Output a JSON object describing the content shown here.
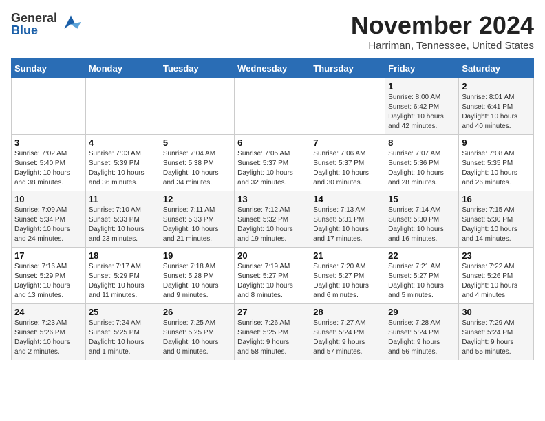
{
  "header": {
    "logo_general": "General",
    "logo_blue": "Blue",
    "month_year": "November 2024",
    "location": "Harriman, Tennessee, United States"
  },
  "days_of_week": [
    "Sunday",
    "Monday",
    "Tuesday",
    "Wednesday",
    "Thursday",
    "Friday",
    "Saturday"
  ],
  "weeks": [
    [
      {
        "day": "",
        "info": ""
      },
      {
        "day": "",
        "info": ""
      },
      {
        "day": "",
        "info": ""
      },
      {
        "day": "",
        "info": ""
      },
      {
        "day": "",
        "info": ""
      },
      {
        "day": "1",
        "info": "Sunrise: 8:00 AM\nSunset: 6:42 PM\nDaylight: 10 hours\nand 42 minutes."
      },
      {
        "day": "2",
        "info": "Sunrise: 8:01 AM\nSunset: 6:41 PM\nDaylight: 10 hours\nand 40 minutes."
      }
    ],
    [
      {
        "day": "3",
        "info": "Sunrise: 7:02 AM\nSunset: 5:40 PM\nDaylight: 10 hours\nand 38 minutes."
      },
      {
        "day": "4",
        "info": "Sunrise: 7:03 AM\nSunset: 5:39 PM\nDaylight: 10 hours\nand 36 minutes."
      },
      {
        "day": "5",
        "info": "Sunrise: 7:04 AM\nSunset: 5:38 PM\nDaylight: 10 hours\nand 34 minutes."
      },
      {
        "day": "6",
        "info": "Sunrise: 7:05 AM\nSunset: 5:37 PM\nDaylight: 10 hours\nand 32 minutes."
      },
      {
        "day": "7",
        "info": "Sunrise: 7:06 AM\nSunset: 5:37 PM\nDaylight: 10 hours\nand 30 minutes."
      },
      {
        "day": "8",
        "info": "Sunrise: 7:07 AM\nSunset: 5:36 PM\nDaylight: 10 hours\nand 28 minutes."
      },
      {
        "day": "9",
        "info": "Sunrise: 7:08 AM\nSunset: 5:35 PM\nDaylight: 10 hours\nand 26 minutes."
      }
    ],
    [
      {
        "day": "10",
        "info": "Sunrise: 7:09 AM\nSunset: 5:34 PM\nDaylight: 10 hours\nand 24 minutes."
      },
      {
        "day": "11",
        "info": "Sunrise: 7:10 AM\nSunset: 5:33 PM\nDaylight: 10 hours\nand 23 minutes."
      },
      {
        "day": "12",
        "info": "Sunrise: 7:11 AM\nSunset: 5:33 PM\nDaylight: 10 hours\nand 21 minutes."
      },
      {
        "day": "13",
        "info": "Sunrise: 7:12 AM\nSunset: 5:32 PM\nDaylight: 10 hours\nand 19 minutes."
      },
      {
        "day": "14",
        "info": "Sunrise: 7:13 AM\nSunset: 5:31 PM\nDaylight: 10 hours\nand 17 minutes."
      },
      {
        "day": "15",
        "info": "Sunrise: 7:14 AM\nSunset: 5:30 PM\nDaylight: 10 hours\nand 16 minutes."
      },
      {
        "day": "16",
        "info": "Sunrise: 7:15 AM\nSunset: 5:30 PM\nDaylight: 10 hours\nand 14 minutes."
      }
    ],
    [
      {
        "day": "17",
        "info": "Sunrise: 7:16 AM\nSunset: 5:29 PM\nDaylight: 10 hours\nand 13 minutes."
      },
      {
        "day": "18",
        "info": "Sunrise: 7:17 AM\nSunset: 5:29 PM\nDaylight: 10 hours\nand 11 minutes."
      },
      {
        "day": "19",
        "info": "Sunrise: 7:18 AM\nSunset: 5:28 PM\nDaylight: 10 hours\nand 9 minutes."
      },
      {
        "day": "20",
        "info": "Sunrise: 7:19 AM\nSunset: 5:27 PM\nDaylight: 10 hours\nand 8 minutes."
      },
      {
        "day": "21",
        "info": "Sunrise: 7:20 AM\nSunset: 5:27 PM\nDaylight: 10 hours\nand 6 minutes."
      },
      {
        "day": "22",
        "info": "Sunrise: 7:21 AM\nSunset: 5:27 PM\nDaylight: 10 hours\nand 5 minutes."
      },
      {
        "day": "23",
        "info": "Sunrise: 7:22 AM\nSunset: 5:26 PM\nDaylight: 10 hours\nand 4 minutes."
      }
    ],
    [
      {
        "day": "24",
        "info": "Sunrise: 7:23 AM\nSunset: 5:26 PM\nDaylight: 10 hours\nand 2 minutes."
      },
      {
        "day": "25",
        "info": "Sunrise: 7:24 AM\nSunset: 5:25 PM\nDaylight: 10 hours\nand 1 minute."
      },
      {
        "day": "26",
        "info": "Sunrise: 7:25 AM\nSunset: 5:25 PM\nDaylight: 10 hours\nand 0 minutes."
      },
      {
        "day": "27",
        "info": "Sunrise: 7:26 AM\nSunset: 5:25 PM\nDaylight: 9 hours\nand 58 minutes."
      },
      {
        "day": "28",
        "info": "Sunrise: 7:27 AM\nSunset: 5:24 PM\nDaylight: 9 hours\nand 57 minutes."
      },
      {
        "day": "29",
        "info": "Sunrise: 7:28 AM\nSunset: 5:24 PM\nDaylight: 9 hours\nand 56 minutes."
      },
      {
        "day": "30",
        "info": "Sunrise: 7:29 AM\nSunset: 5:24 PM\nDaylight: 9 hours\nand 55 minutes."
      }
    ]
  ]
}
